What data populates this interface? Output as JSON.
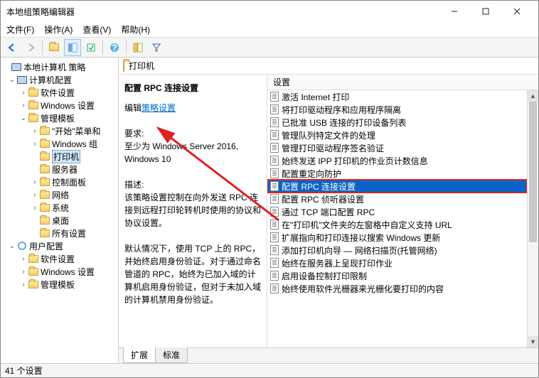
{
  "window": {
    "title": "本地组策略编辑器"
  },
  "menu": {
    "file": "文件(F)",
    "action": "操作(A)",
    "view": "查看(V)",
    "help": "帮助(H)"
  },
  "tree": {
    "root": "本地计算机 策略",
    "computerConfig": "计算机配置",
    "software": "软件设置",
    "windows": "Windows 设置",
    "adminTemplates": "管理模板",
    "startMenu": "\"开始\"菜单和",
    "windowsComp": "Windows 组",
    "printers": "打印机",
    "server": "服务器",
    "controlPanel": "控制面板",
    "network": "网络",
    "system": "系统",
    "desktop": "桌面",
    "allSettings": "所有设置",
    "userConfig": "用户配置",
    "software2": "软件设置",
    "windows2": "Windows 设置",
    "adminTemplates2": "管理模板"
  },
  "path": {
    "label": "打印机"
  },
  "detail": {
    "heading": "配置 RPC 连接设置",
    "editPrefix": "编辑",
    "editLink": "策略设置",
    "reqLabel": "要求:",
    "reqText": "至少为 Windows Server 2016, Windows 10",
    "descLabel": "描述:",
    "descPara1": "该策略设置控制在向外发送 RPC 连接到远程打印轮转机时使用的协议和协议设置。",
    "descPara2": "默认情况下，使用 TCP 上的 RPC，并始终启用身份验证。对于通过命名管道的 RPC，始终为已加入域的计算机启用身份验证，但对于未加入域的计算机禁用身份验证。"
  },
  "list": {
    "header": "设置",
    "items": [
      "激活 Internet 打印",
      "将打印驱动程序和应用程序隔离",
      "已批准 USB 连接的打印设备列表",
      "管理队列特定文件的处理",
      "管理打印驱动程序签名验证",
      "始终发送 IPP 打印机的作业页计数信息",
      "配置重定向防护",
      "配置 RPC 连接设置",
      "配置 RPC 侦听器设置",
      "通过 TCP 端口配置 RPC",
      "在\"打印机\"文件夹的左窗格中自定义支持 URL",
      "扩展指向和打印连接以搜索 Windows 更新",
      "添加打印机向导 — 网络扫描页(托管网络)",
      "始终在服务器上呈现打印作业",
      "启用设备控制打印限制",
      "始终使用软件光栅器来光栅化要打印的内容"
    ],
    "selectedIndex": 7
  },
  "tabs": {
    "ext": "扩展",
    "std": "标准"
  },
  "status": {
    "text": "41 个设置"
  }
}
